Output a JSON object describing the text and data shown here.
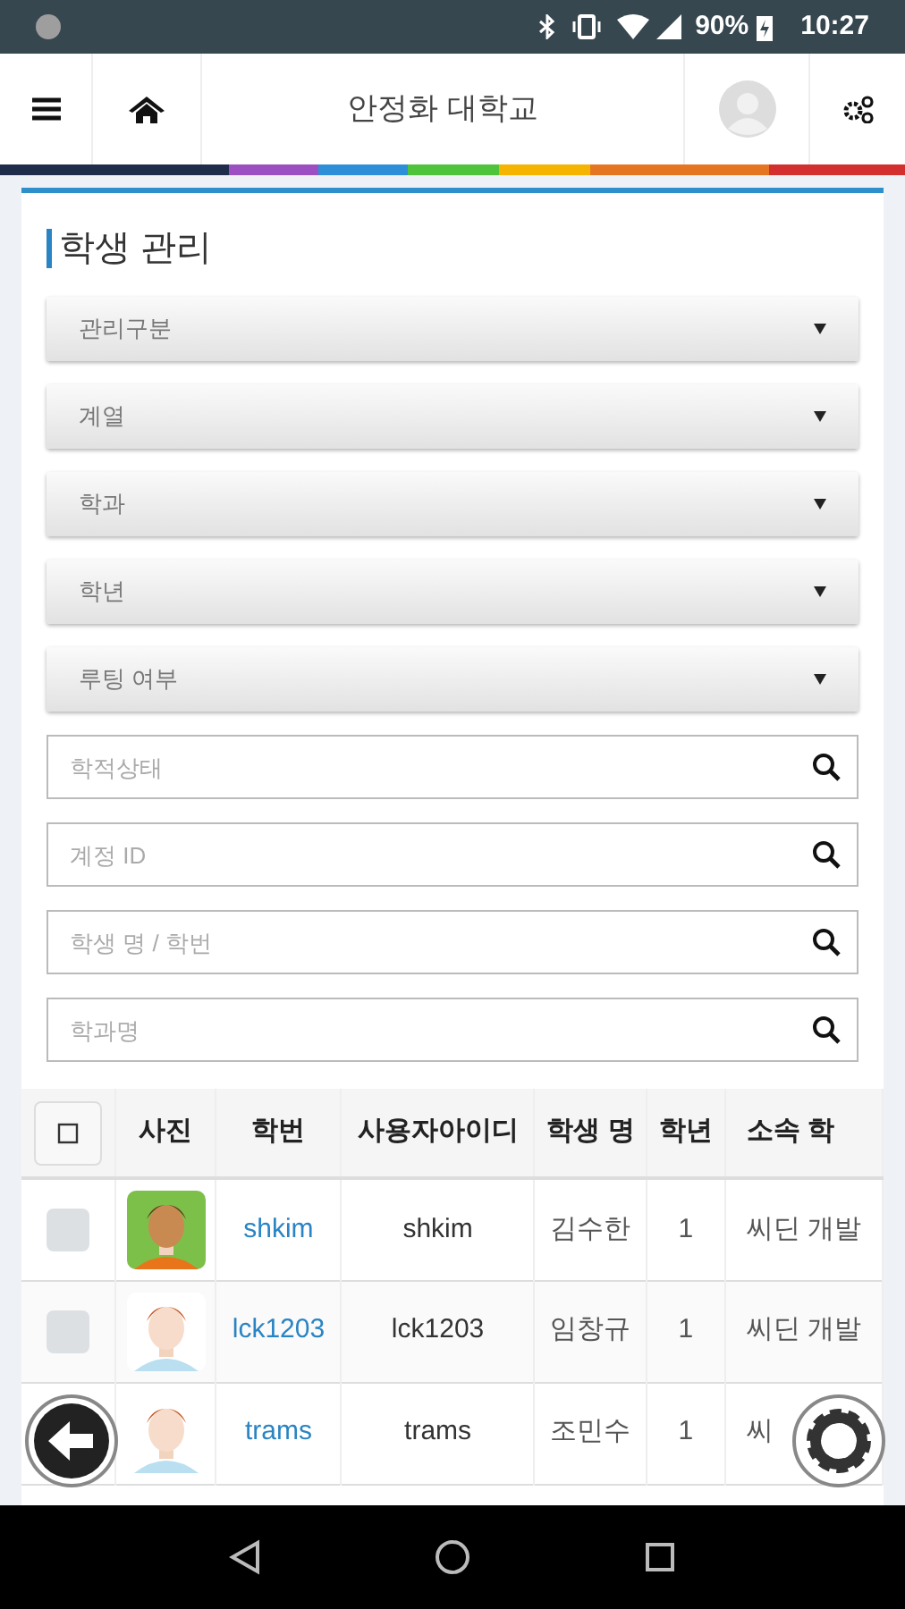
{
  "status_bar": {
    "battery": "90%",
    "time": "10:27"
  },
  "app_bar": {
    "title": "안정화 대학교"
  },
  "panel": {
    "title": "학생 관리",
    "filters": [
      {
        "kind": "select",
        "placeholder": "관리구분"
      },
      {
        "kind": "select",
        "placeholder": "계열"
      },
      {
        "kind": "select",
        "placeholder": "학과"
      },
      {
        "kind": "select",
        "placeholder": "학년"
      },
      {
        "kind": "select",
        "placeholder": "루팅 여부"
      },
      {
        "kind": "search",
        "placeholder": "학적상태"
      },
      {
        "kind": "search",
        "placeholder": "계정 ID"
      },
      {
        "kind": "search",
        "placeholder": "학생 명 / 학번"
      },
      {
        "kind": "search",
        "placeholder": "학과명"
      }
    ]
  },
  "table": {
    "select_all": {
      "checked": false
    },
    "columns": [
      "사진",
      "학번",
      "사용자아이디",
      "학생 명",
      "학년",
      "소속 학"
    ],
    "rows": [
      {
        "checked": false,
        "student_number": "shkim",
        "user_id": "shkim",
        "name": "김수한",
        "year": "1",
        "department": "씨딘 개발"
      },
      {
        "checked": false,
        "student_number": "lck1203",
        "user_id": "lck1203",
        "name": "임창규",
        "year": "1",
        "department": "씨딘 개발"
      },
      {
        "student_number": "trams",
        "user_id": "trams",
        "name": "조민수",
        "year": "1",
        "department": "씨"
      }
    ]
  }
}
